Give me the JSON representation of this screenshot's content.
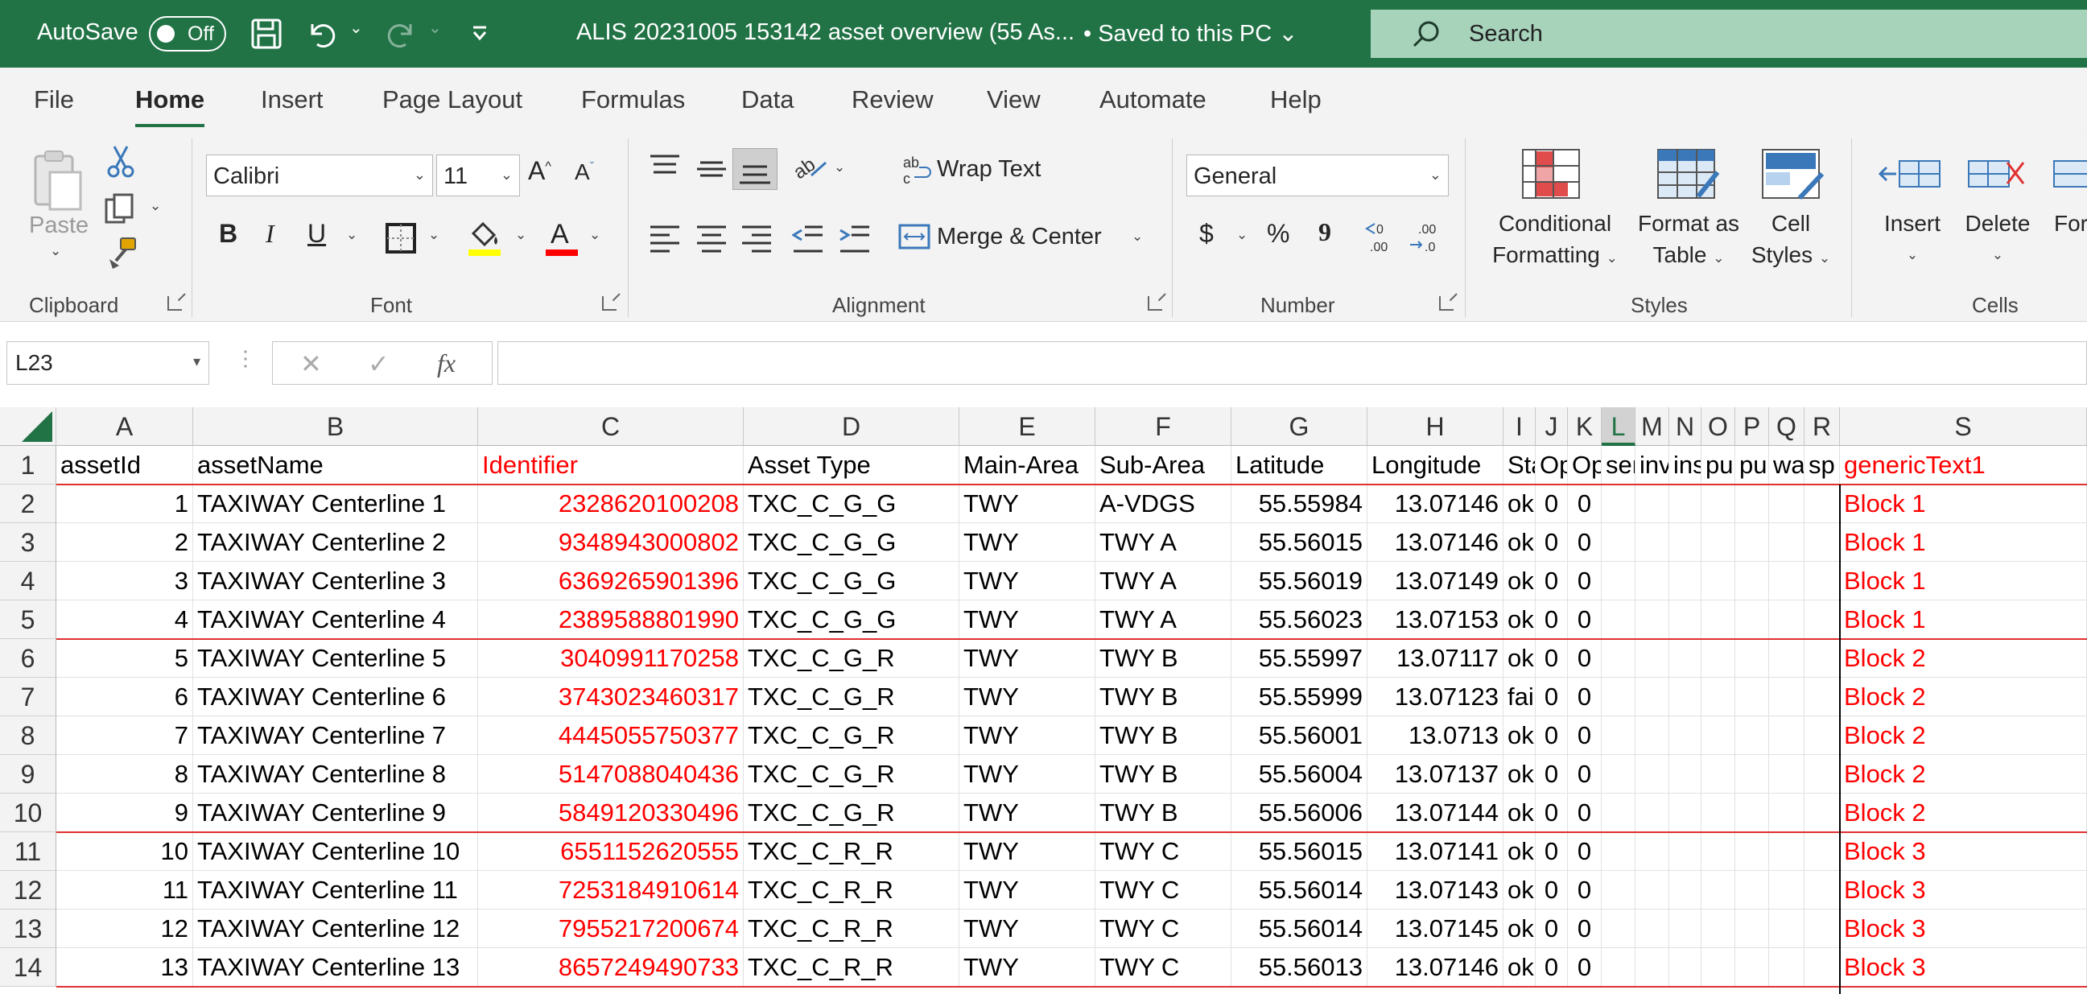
{
  "titlebar": {
    "autosave_label": "AutoSave",
    "toggle_state": "Off",
    "doc_title": "ALIS 20231005 153142 asset overview (55 As...",
    "saved_status": "• Saved to this PC",
    "search_placeholder": "Search"
  },
  "tabs": [
    "File",
    "Home",
    "Insert",
    "Page Layout",
    "Formulas",
    "Data",
    "Review",
    "View",
    "Automate",
    "Help"
  ],
  "active_tab": "Home",
  "ribbon": {
    "clipboard": {
      "paste_label": "Paste",
      "group_label": "Clipboard"
    },
    "font": {
      "font_name": "Calibri",
      "font_size": "11",
      "group_label": "Font",
      "highlight_color": "#ffff00",
      "font_color": "#ff0000"
    },
    "alignment": {
      "wrap_text": "Wrap Text",
      "merge_center": "Merge & Center",
      "group_label": "Alignment"
    },
    "number": {
      "format": "General",
      "group_label": "Number",
      "currency": "$",
      "percent": "%",
      "comma": "9"
    },
    "styles": {
      "conditional_1": "Conditional",
      "conditional_2": "Formatting",
      "format_table_1": "Format as",
      "format_table_2": "Table",
      "cell_styles_1": "Cell",
      "cell_styles_2": "Styles",
      "group_label": "Styles"
    },
    "cells": {
      "insert": "Insert",
      "delete": "Delete",
      "format": "Form",
      "group_label": "Cells"
    }
  },
  "formula_bar": {
    "name_box": "L23",
    "fx": "fx",
    "formula": ""
  },
  "grid": {
    "columns": [
      "A",
      "B",
      "C",
      "D",
      "E",
      "F",
      "G",
      "H",
      "I",
      "J",
      "K",
      "L",
      "M",
      "N",
      "O",
      "P",
      "Q",
      "R",
      "S"
    ],
    "selected_column": "L",
    "header_row": [
      "assetId",
      "assetName",
      "Identifier",
      "Asset Type",
      "Main-Area",
      "Sub-Area",
      "Latitude",
      "Longitude",
      "Sta",
      "Op",
      "Op",
      "ser",
      "inv",
      "ins",
      "pu",
      "pu",
      "wa",
      "sp",
      "genericText1"
    ],
    "rows": [
      [
        "1",
        "TAXIWAY Centerline 1",
        "2328620100208",
        "TXC_C_G_G",
        "TWY",
        "A-VDGS",
        "55.55984",
        "13.07146",
        "ok",
        "0",
        "0",
        "",
        "",
        "",
        "",
        "",
        "",
        "",
        "Block 1"
      ],
      [
        "2",
        "TAXIWAY Centerline 2",
        "9348943000802",
        "TXC_C_G_G",
        "TWY",
        "TWY A",
        "55.56015",
        "13.07146",
        "ok",
        "0",
        "0",
        "",
        "",
        "",
        "",
        "",
        "",
        "",
        "Block 1"
      ],
      [
        "3",
        "TAXIWAY Centerline 3",
        "6369265901396",
        "TXC_C_G_G",
        "TWY",
        "TWY A",
        "55.56019",
        "13.07149",
        "ok",
        "0",
        "0",
        "",
        "",
        "",
        "",
        "",
        "",
        "",
        "Block 1"
      ],
      [
        "4",
        "TAXIWAY Centerline 4",
        "2389588801990",
        "TXC_C_G_G",
        "TWY",
        "TWY A",
        "55.56023",
        "13.07153",
        "ok",
        "0",
        "0",
        "",
        "",
        "",
        "",
        "",
        "",
        "",
        "Block 1"
      ],
      [
        "5",
        "TAXIWAY Centerline 5",
        "3040991170258",
        "TXC_C_G_R",
        "TWY",
        "TWY B",
        "55.55997",
        "13.07117",
        "ok",
        "0",
        "0",
        "",
        "",
        "",
        "",
        "",
        "",
        "",
        "Block 2"
      ],
      [
        "6",
        "TAXIWAY Centerline 6",
        "3743023460317",
        "TXC_C_G_R",
        "TWY",
        "TWY B",
        "55.55999",
        "13.07123",
        "fai",
        "0",
        "0",
        "",
        "",
        "",
        "",
        "",
        "",
        "",
        "Block 2"
      ],
      [
        "7",
        "TAXIWAY Centerline 7",
        "4445055750377",
        "TXC_C_G_R",
        "TWY",
        "TWY B",
        "55.56001",
        "13.0713",
        "ok",
        "0",
        "0",
        "",
        "",
        "",
        "",
        "",
        "",
        "",
        "Block 2"
      ],
      [
        "8",
        "TAXIWAY Centerline 8",
        "5147088040436",
        "TXC_C_G_R",
        "TWY",
        "TWY B",
        "55.56004",
        "13.07137",
        "ok",
        "0",
        "0",
        "",
        "",
        "",
        "",
        "",
        "",
        "",
        "Block 2"
      ],
      [
        "9",
        "TAXIWAY Centerline 9",
        "5849120330496",
        "TXC_C_G_R",
        "TWY",
        "TWY B",
        "55.56006",
        "13.07144",
        "ok",
        "0",
        "0",
        "",
        "",
        "",
        "",
        "",
        "",
        "",
        "Block 2"
      ],
      [
        "10",
        "TAXIWAY Centerline 10",
        "6551152620555",
        "TXC_C_R_R",
        "TWY",
        "TWY C",
        "55.56015",
        "13.07141",
        "ok",
        "0",
        "0",
        "",
        "",
        "",
        "",
        "",
        "",
        "",
        "Block 3"
      ],
      [
        "11",
        "TAXIWAY Centerline 11",
        "7253184910614",
        "TXC_C_R_R",
        "TWY",
        "TWY C",
        "55.56014",
        "13.07143",
        "ok",
        "0",
        "0",
        "",
        "",
        "",
        "",
        "",
        "",
        "",
        "Block 3"
      ],
      [
        "12",
        "TAXIWAY Centerline 12",
        "7955217200674",
        "TXC_C_R_R",
        "TWY",
        "TWY C",
        "55.56014",
        "13.07145",
        "ok",
        "0",
        "0",
        "",
        "",
        "",
        "",
        "",
        "",
        "",
        "Block 3"
      ],
      [
        "13",
        "TAXIWAY Centerline 13",
        "8657249490733",
        "TXC_C_R_R",
        "TWY",
        "TWY C",
        "55.56013",
        "13.07146",
        "ok",
        "0",
        "0",
        "",
        "",
        "",
        "",
        "",
        "",
        "",
        "Block 3"
      ]
    ]
  },
  "colors": {
    "excel_green": "#217346",
    "red_text": "#ff0000",
    "block_border": "#e03030"
  }
}
